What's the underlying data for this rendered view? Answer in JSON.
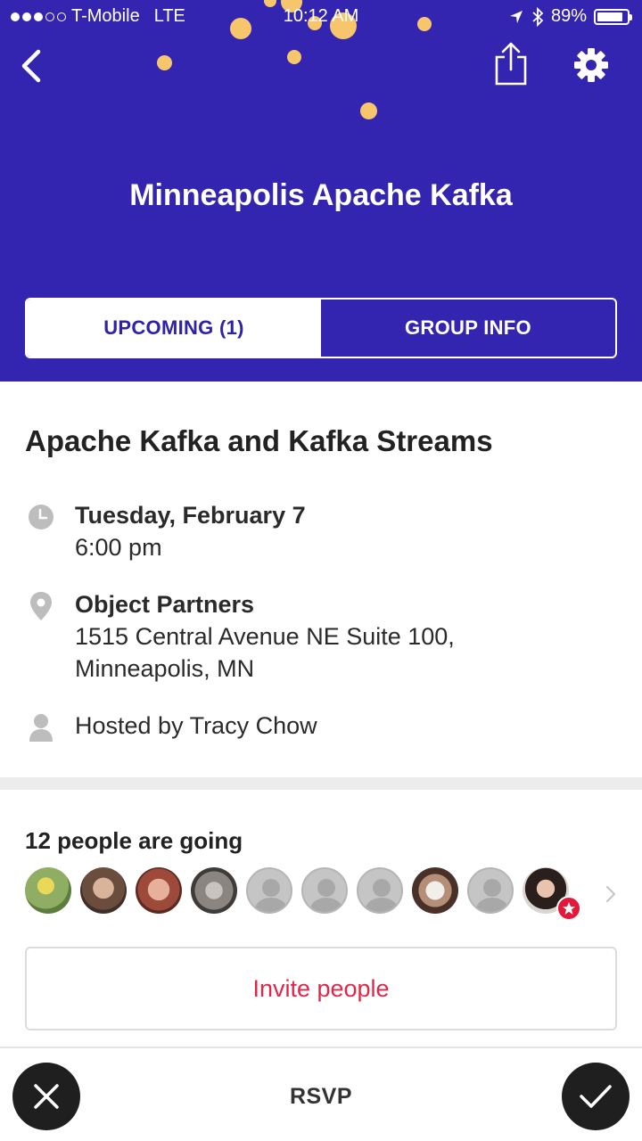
{
  "status_bar": {
    "carrier": "T-Mobile",
    "network": "LTE",
    "time": "10:12 AM",
    "battery": "89%",
    "battery_level": 0.89
  },
  "header": {
    "group_name": "Minneapolis Apache Kafka",
    "background_color": "#3325b0",
    "confetti_color": "#f7c66c",
    "icons": [
      "back-chevron-icon",
      "share-icon",
      "settings-gear-icon"
    ]
  },
  "tabs": [
    {
      "label": "UPCOMING (1)",
      "active": true
    },
    {
      "label": "GROUP INFO",
      "active": false
    }
  ],
  "event": {
    "title": "Apache Kafka and Kafka Streams",
    "date": "Tuesday, February 7",
    "time": "6:00 pm",
    "venue": "Object Partners",
    "address_line1": "1515 Central Avenue NE Suite 100,",
    "address_line2": "Minneapolis, MN",
    "host": "Hosted by Tracy Chow"
  },
  "attendees": {
    "title": "12 people are going",
    "avatars": [
      {
        "kind": "photo",
        "color": "#8fae63"
      },
      {
        "kind": "photo",
        "color": "#7a5b48"
      },
      {
        "kind": "photo",
        "color": "#9e4a3a"
      },
      {
        "kind": "photo",
        "color": "#8a8580"
      },
      {
        "kind": "blank"
      },
      {
        "kind": "blank"
      },
      {
        "kind": "blank"
      },
      {
        "kind": "photo",
        "color": "#6b4a3c"
      },
      {
        "kind": "blank"
      },
      {
        "kind": "photo",
        "color": "#3a2c28",
        "badge": "star-badge-icon"
      }
    ]
  },
  "invite_button": "Invite people",
  "bottom_bar": {
    "rsvp_label": "RSVP",
    "accent_color": "#e0274a"
  }
}
